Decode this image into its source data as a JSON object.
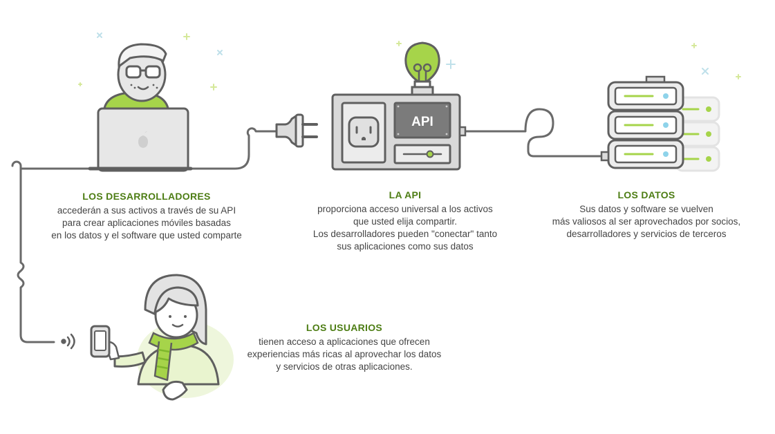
{
  "colors": {
    "accent": "#a6d44a",
    "heading": "#4d7d14",
    "stroke": "#5f5f5f",
    "fill_gray": "#dcdcdc",
    "text": "#444444"
  },
  "icons": [
    "developer-icon",
    "laptop-icon",
    "plug-icon",
    "api-box-icon",
    "lightbulb-icon",
    "outlet-icon",
    "server-stack-icon",
    "user-with-phone-icon",
    "phone-icon",
    "signal-icon"
  ],
  "api_box": {
    "label": "API"
  },
  "sections": {
    "developers": {
      "heading": "LOS DESARROLLADORES",
      "lines": [
        "accederán a sus activos a través de su API",
        "para crear aplicaciones móviles basadas",
        "en los datos y el software que usted comparte"
      ]
    },
    "api": {
      "heading": "LA API",
      "lines": [
        "proporciona acceso universal a los activos",
        "que usted elija compartir.",
        "Los desarrolladores pueden \"conectar\" tanto",
        "sus aplicaciones como sus datos"
      ]
    },
    "data": {
      "heading": "LOS DATOS",
      "lines": [
        "Sus datos y software se vuelven",
        "más valiosos al ser aprovechados por socios,",
        "desarrolladores y servicios de terceros"
      ]
    },
    "users": {
      "heading": "LOS USUARIOS",
      "lines": [
        "tienen acceso a aplicaciones que ofrecen",
        "experiencias más ricas al aprovechar los datos",
        "y servicios de otras aplicaciones."
      ]
    }
  }
}
